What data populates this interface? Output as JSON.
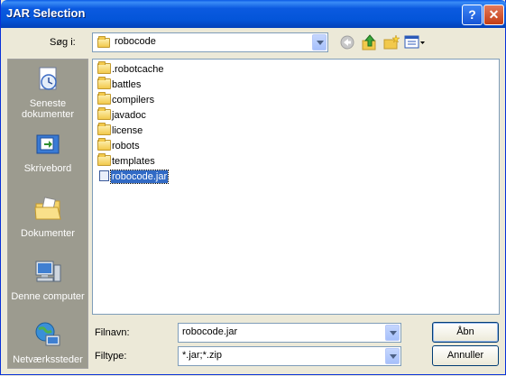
{
  "window": {
    "title": "JAR Selection"
  },
  "titlebar": {
    "help_label": "?",
    "close_label": "✕"
  },
  "look_in": {
    "label": "Søg i:",
    "value": "robocode"
  },
  "toolbar": {
    "back_icon": "back-arrow-icon",
    "up_icon": "up-folder-icon",
    "new_folder_icon": "new-folder-icon",
    "view_icon": "view-menu-icon"
  },
  "places": [
    {
      "label": "Seneste dokumenter",
      "icon": "recent-documents-icon"
    },
    {
      "label": "Skrivebord",
      "icon": "desktop-icon"
    },
    {
      "label": "Dokumenter",
      "icon": "my-documents-icon"
    },
    {
      "label": "Denne computer",
      "icon": "my-computer-icon"
    },
    {
      "label": "Netværkssteder",
      "icon": "network-places-icon"
    }
  ],
  "files": [
    {
      "name": ".robotcache",
      "type": "folder"
    },
    {
      "name": "battles",
      "type": "folder"
    },
    {
      "name": "compilers",
      "type": "folder"
    },
    {
      "name": "javadoc",
      "type": "folder"
    },
    {
      "name": "license",
      "type": "folder"
    },
    {
      "name": "robots",
      "type": "folder"
    },
    {
      "name": "templates",
      "type": "folder"
    },
    {
      "name": "robocode.jar",
      "type": "jar",
      "selected": true
    }
  ],
  "filename": {
    "label": "Filnavn:",
    "value": "robocode.jar"
  },
  "filetype": {
    "label": "Filtype:",
    "value": "*.jar;*.zip"
  },
  "buttons": {
    "open": "Åbn",
    "cancel": "Annuller"
  }
}
